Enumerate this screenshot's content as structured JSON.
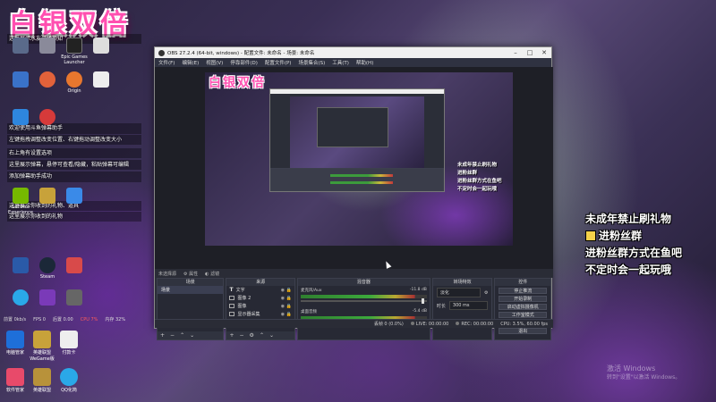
{
  "stream_title": "白银双倍",
  "left_notes": [
    "这里展示水友进场须知",
    "欢迎使用斗鱼弹幕助手",
    "左键拖拽调整改变位置、右键拖动调整改变大小",
    "右上角有设置选项",
    "这里展示弹幕，悬停可查看/隐藏，粘贴弹幕可编辑",
    "添加弹幕助手成功",
    "这里展示你收到的礼物、道具",
    "这里展示你收到的礼物",
    "这里展示最新关注你的人"
  ],
  "desktop_icons": [
    {
      "label": "",
      "icon": "monitor-icon",
      "color": "#5a6a8a"
    },
    {
      "label": "",
      "icon": "recycle-bin-icon",
      "color": "#8a8a9a"
    },
    {
      "label": "Epic Games Launcher",
      "icon": "epic-games-icon",
      "color": "#222"
    },
    {
      "label": "",
      "icon": "document-icon",
      "color": "#ddd"
    },
    {
      "label": "",
      "icon": "app-icon",
      "color": "#3a72c8"
    },
    {
      "label": "",
      "icon": "app-icon",
      "color": "#e2623a"
    },
    {
      "label": "Origin",
      "icon": "origin-icon",
      "color": "#e8772e"
    },
    {
      "label": "",
      "icon": "document-icon",
      "color": "#eee"
    },
    {
      "label": "",
      "icon": "app-icon",
      "color": "#2e86de"
    },
    {
      "label": "",
      "icon": "netease-music-icon",
      "color": "#d63a3a"
    },
    {
      "label": "",
      "icon": "app-icon",
      "color": "#5a5a5a"
    },
    {
      "label": "GeForce Experience",
      "icon": "geforce-icon",
      "color": "#76b900"
    },
    {
      "label": "",
      "icon": "app-icon",
      "color": "#c8a23a"
    },
    {
      "label": "",
      "icon": "windows-icon",
      "color": "#3a8ae8"
    },
    {
      "label": "",
      "icon": "app-icon",
      "color": "#888"
    },
    {
      "label": "",
      "icon": "app-icon",
      "color": "#2a5aa8"
    },
    {
      "label": "Steam",
      "icon": "steam-icon",
      "color": "#1b2838"
    },
    {
      "label": "",
      "icon": "app-icon",
      "color": "#d84a4a"
    },
    {
      "label": "",
      "icon": "qq-icon",
      "color": "#2aa8e8"
    },
    {
      "label": "",
      "icon": "app-icon",
      "color": "#7a3ab8"
    },
    {
      "label": "",
      "icon": "app-icon",
      "color": "#666"
    }
  ],
  "perf_line": {
    "a": "前置 0kb/s",
    "b": "FPS 0",
    "c": "后置 0.00",
    "d": "CPU 7%",
    "e": "内存 32%"
  },
  "bottom_icons": [
    {
      "label": "电脑管家",
      "icon": "pc-manager-icon",
      "color": "#1e6fd9"
    },
    {
      "label": "英雄联盟 WeGame版",
      "icon": "lol-icon",
      "color": "#c8a23a"
    },
    {
      "label": "付款卡",
      "icon": "document-icon",
      "color": "#eee"
    },
    {
      "label": "软件管家",
      "icon": "software-manager-icon",
      "color": "#e84a6a"
    },
    {
      "label": "英雄联盟",
      "icon": "lol-icon",
      "color": "#b8923a"
    },
    {
      "label": "QQ化简",
      "icon": "qq-icon",
      "color": "#2aa8e8"
    }
  ],
  "overlay": {
    "line1": "未成年禁止刷礼物",
    "line2": "进粉丝群",
    "line3": "进粉丝群方式在鱼吧",
    "line4": "不定时会一起玩哦"
  },
  "watermark": {
    "line1": "激活 Windows",
    "line2": "转到\"设置\"以激活 Windows。"
  },
  "obs": {
    "title": "OBS 27.2.4 (64-bit, windows) - 配置文件: 未命名 - 场景: 未命名",
    "menu": [
      "文件(F)",
      "编辑(E)",
      "视图(V)",
      "停靠部件(D)",
      "配置文件(P)",
      "场景集合(S)",
      "工具(T)",
      "帮助(H)"
    ],
    "scene_bar": {
      "label": "未选择源",
      "props": "属性",
      "filters": "滤镜"
    },
    "docks": {
      "scenes_header": "场景",
      "sources_header": "来源",
      "mixer_header": "混音器",
      "transitions_header": "转场特效",
      "controls_header": "控件"
    },
    "scene_items": [
      "场景"
    ],
    "sources": [
      {
        "name": "文字",
        "icon": "text-icon"
      },
      {
        "name": "图像 2",
        "icon": "image-icon"
      },
      {
        "name": "图像",
        "icon": "image-icon"
      },
      {
        "name": "显示器采集",
        "icon": "monitor-capture-icon"
      }
    ],
    "mixer": [
      {
        "name": "麦克风/Aux",
        "db": "-11.8 dB"
      },
      {
        "name": "桌面音频",
        "db": "-5.4 dB"
      }
    ],
    "transition": {
      "type": "淡化",
      "duration_label": "时长",
      "duration": "300 ms"
    },
    "controls": [
      "停止推流",
      "开始录制",
      "启动虚拟摄像机",
      "工作室模式",
      "设置",
      "退出"
    ],
    "status": {
      "live": "LIVE: 00:00:00",
      "rec": "REC: 00:00:00",
      "cpu": "CPU: 3.5%, 60.00 fps",
      "dropped": "丢帧 0 (0.0%)"
    }
  }
}
